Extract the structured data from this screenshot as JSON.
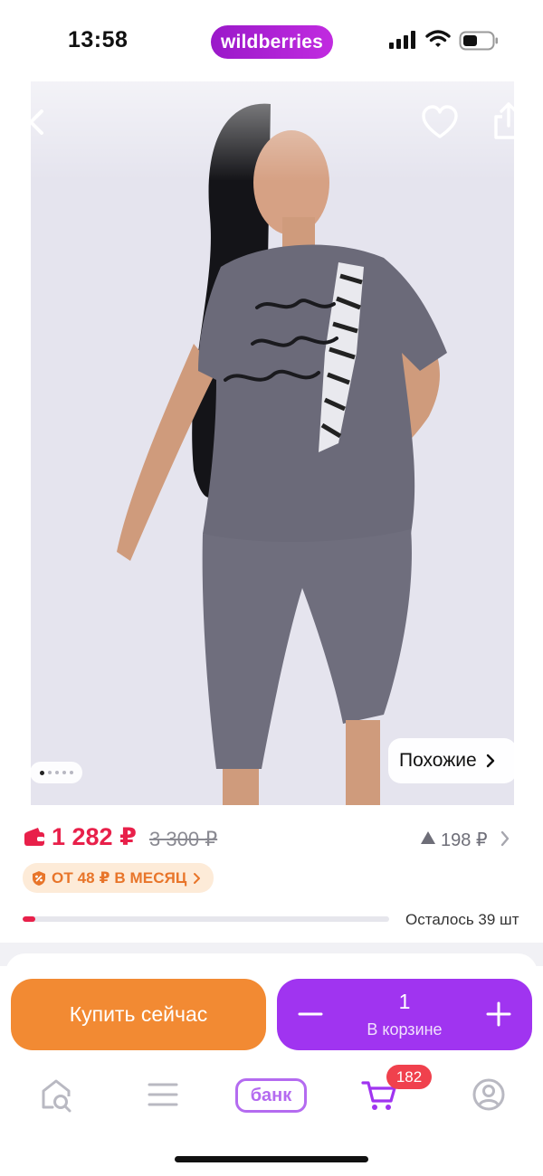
{
  "status_bar": {
    "time": "13:58",
    "brand": "wildberries",
    "icons": [
      "signal-icon",
      "wifi-icon",
      "battery-icon"
    ]
  },
  "gallery": {
    "image_index": 1,
    "image_count": 5,
    "similar_label": "Похожие",
    "icons": [
      "back-icon",
      "heart-icon",
      "share-icon",
      "chevron-right-icon"
    ]
  },
  "price": {
    "current": "1 282 ₽",
    "old": "3 300 ₽",
    "drop": "198 ₽",
    "installment": "ОТ 48 ₽ В МЕСЯЦ",
    "stock_text": "Осталось 39 шт",
    "stock_fill_fraction": 0.035,
    "colors": {
      "price_red": "#e8204a",
      "installment_orange": "#e8752a"
    }
  },
  "actions": {
    "buy_now": "Купить сейчас",
    "cart_quantity": "1",
    "cart_label": "В корзине",
    "colors": {
      "buy_now": "#f28a33",
      "cart": "#a034f0"
    }
  },
  "bottom_nav": {
    "items": [
      "home-search-icon",
      "catalog-menu-icon",
      "bank",
      "cart-icon",
      "profile-icon"
    ],
    "bank_label": "банк",
    "cart_badge": "182",
    "accent": "#b46bf0"
  }
}
